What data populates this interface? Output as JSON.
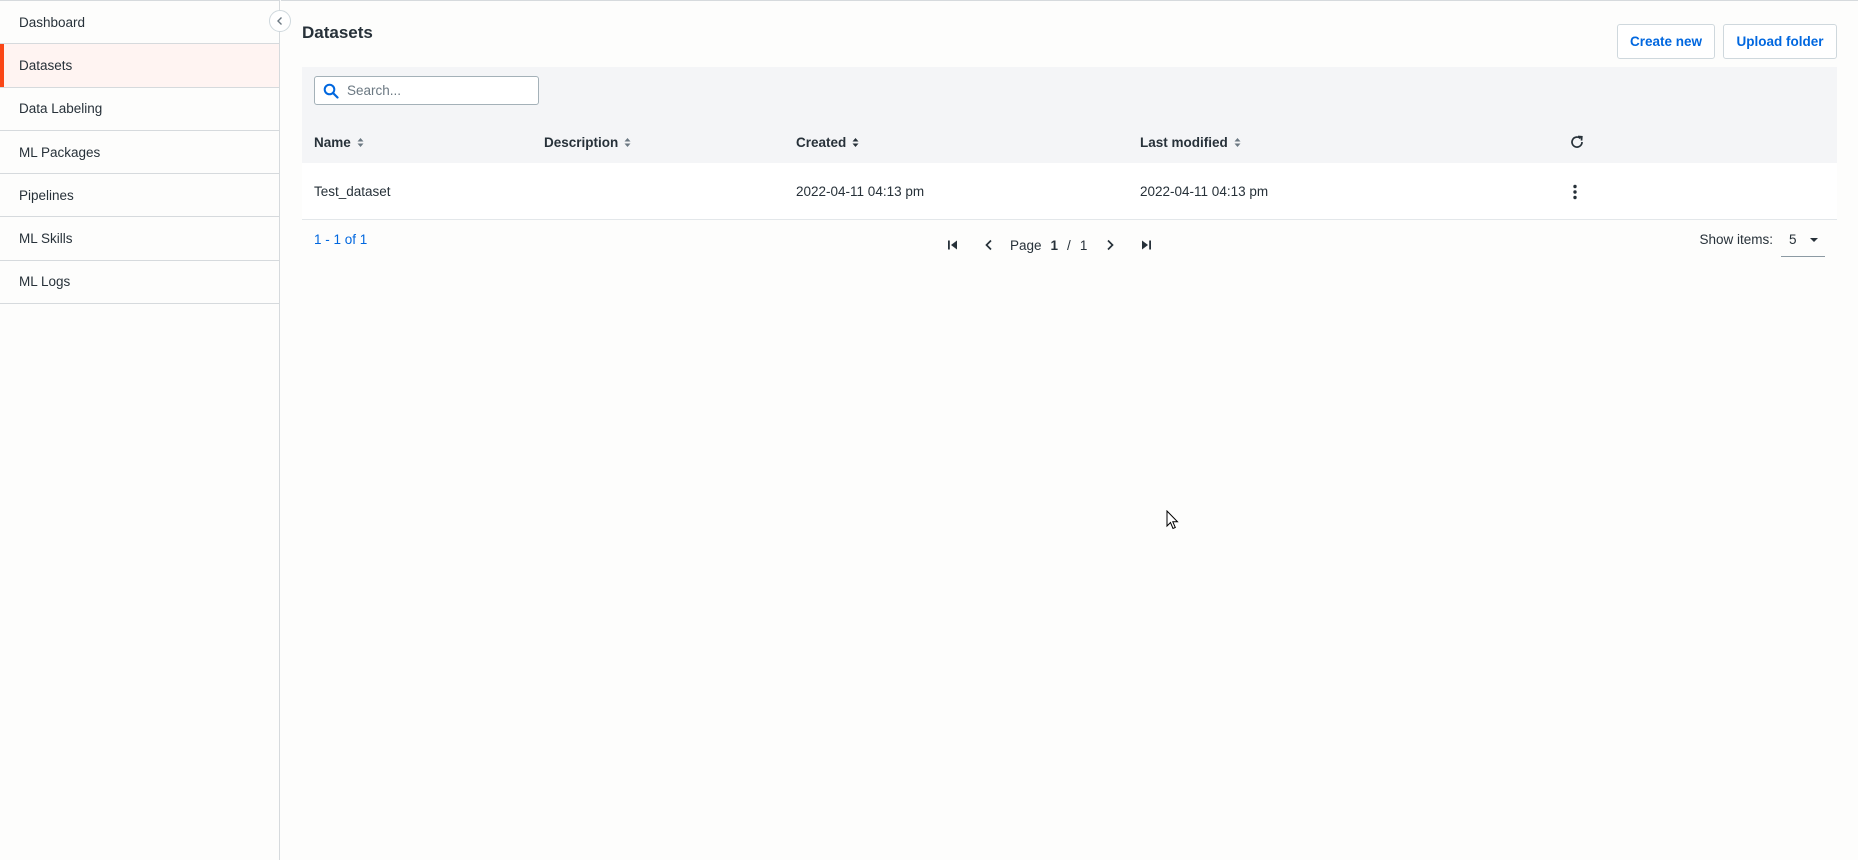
{
  "sidebar": {
    "items": [
      {
        "label": "Dashboard"
      },
      {
        "label": "Datasets"
      },
      {
        "label": "Data Labeling"
      },
      {
        "label": "ML Packages"
      },
      {
        "label": "Pipelines"
      },
      {
        "label": "ML Skills"
      },
      {
        "label": "ML Logs"
      }
    ]
  },
  "header": {
    "title": "Datasets",
    "create_label": "Create new",
    "upload_label": "Upload folder"
  },
  "search": {
    "placeholder": "Search..."
  },
  "table": {
    "columns": [
      "Name",
      "Description",
      "Created",
      "Last modified"
    ],
    "rows": [
      {
        "name": "Test_dataset",
        "description": "",
        "created": "2022-04-11 04:13 pm",
        "modified": "2022-04-11 04:13 pm"
      }
    ]
  },
  "pagination": {
    "range": "1 - 1 of 1",
    "page_label": "Page",
    "current": "1",
    "sep": "/",
    "total": "1",
    "show_label": "Show items:",
    "page_size": "5"
  },
  "colors": {
    "accent": "#fa4616",
    "link": "#0067df",
    "active_bg": "#fff4f2"
  },
  "icons": [
    "chevron-left-icon",
    "search-icon",
    "sort-icon",
    "refresh-icon",
    "more-vertical-icon",
    "first-page-icon",
    "prev-page-icon",
    "next-page-icon",
    "last-page-icon",
    "caret-down-icon",
    "mouse-cursor-icon"
  ]
}
